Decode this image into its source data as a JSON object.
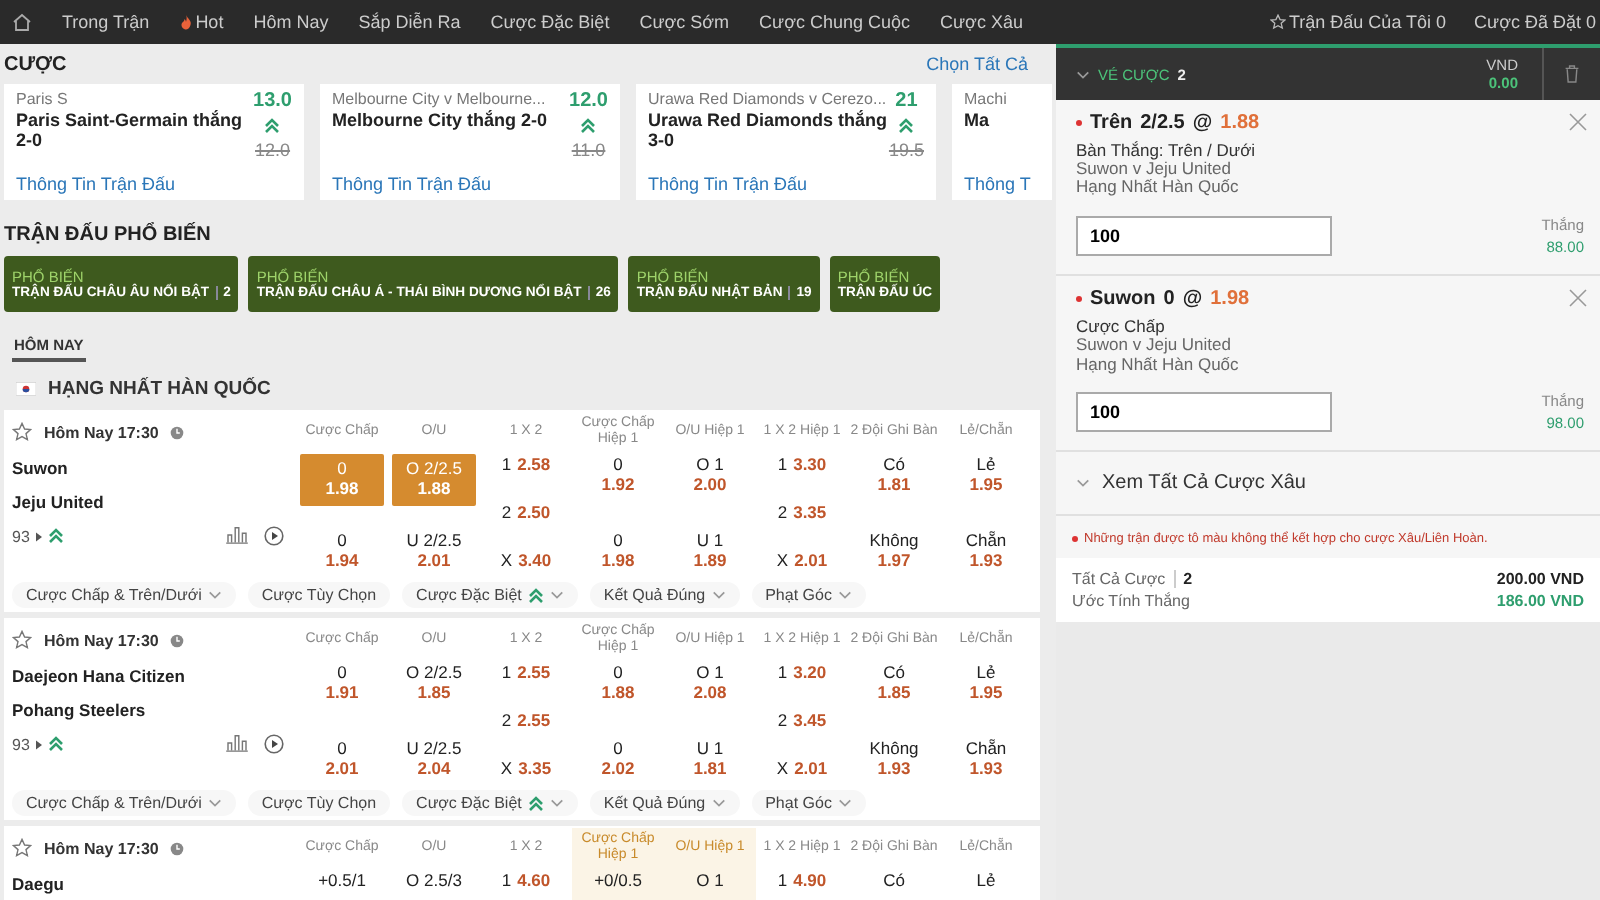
{
  "nav": {
    "items": [
      {
        "label": "Trong Trận",
        "kind": "text"
      },
      {
        "label": "Hot",
        "kind": "hot"
      },
      {
        "label": "Hôm Nay",
        "kind": "text"
      },
      {
        "label": "Sắp Diễn Ra",
        "kind": "text"
      },
      {
        "label": "Cược Đặc Biệt",
        "kind": "text"
      },
      {
        "label": "Cược Sớm",
        "kind": "text"
      },
      {
        "label": "Cược Chung Cuộc",
        "kind": "text"
      },
      {
        "label": "Cược Xâu",
        "kind": "text"
      }
    ],
    "right": [
      {
        "label": "Trận Đấu Của Tôi 0",
        "kind": "star"
      },
      {
        "label": "Cược Đã Đặt 0",
        "kind": "text"
      }
    ]
  },
  "featured": {
    "title": "CƯỢC",
    "select_all": "Chọn Tất Cả",
    "cards": [
      {
        "subtitle": "Paris S",
        "title": "Paris Saint-Germain thắng 2-0",
        "odd": "13.0",
        "old_odd": "12.0",
        "link": "Thông Tin Trận Đấu"
      },
      {
        "subtitle": "Melbourne City v Melbourne...",
        "title": "Melbourne City thắng 2-0",
        "odd": "12.0",
        "old_odd": "11.0",
        "link": "Thông Tin Trận Đấu"
      },
      {
        "subtitle": "Urawa Red Diamonds v Cerezo...",
        "title": "Urawa Red Diamonds thắng 3-0",
        "odd": "21",
        "old_odd": "19.5",
        "link": "Thông Tin Trận Đấu"
      },
      {
        "subtitle": "Machi",
        "title": "Ma",
        "link": "Thông T"
      }
    ]
  },
  "popular": {
    "title": "TRẬN ĐẤU PHỔ BIẾN",
    "cards": [
      {
        "tag": "PHỔ BIẾN",
        "title": "TRẬN ĐẤU CHÂU ÂU NỔI BẬT",
        "count": "2"
      },
      {
        "tag": "PHỔ BIẾN",
        "title": "TRẬN ĐẤU CHÂU Á - THÁI BÌNH DƯƠNG NỔI BẬT",
        "count": "26"
      },
      {
        "tag": "PHỔ BIẾN",
        "title": "TRẬN ĐẤU NHẬT BẢN",
        "count": "19"
      },
      {
        "tag": "PHỔ BIẾN",
        "title": "TRẬN ĐẤU ÚC"
      }
    ]
  },
  "day_tab": {
    "label": "HÔM NAY",
    "selected": true
  },
  "league": "HẠNG NHẤT HÀN QUỐC",
  "matches": [
    {
      "time": "Hôm Nay 17:30",
      "teams": [
        "Suwon",
        "Jeju United"
      ],
      "count": "93",
      "columns": [
        {
          "heading": "Cược Chấp",
          "highlighted": false,
          "kind": "stacked",
          "cells": [
            {
              "label": "0",
              "odd": "1.98",
              "selected": true
            },
            {
              "label": "0",
              "odd": "1.94",
              "selected": false
            }
          ]
        },
        {
          "heading": "O/U",
          "highlighted": false,
          "kind": "stacked",
          "cells": [
            {
              "label": "O 2/2.5",
              "odd": "1.88",
              "selected": true
            },
            {
              "label": "U 2/2.5",
              "odd": "2.01",
              "selected": false
            }
          ]
        },
        {
          "heading": "1 X 2",
          "highlighted": false,
          "kind": "inline",
          "cells": [
            {
              "label": "1",
              "odd": "2.58",
              "selected": false
            },
            {
              "label": "2",
              "odd": "2.50",
              "selected": false
            },
            {
              "label": "X",
              "odd": "3.40",
              "selected": false
            }
          ]
        },
        {
          "heading": "Cược Chấp Hiệp 1",
          "highlighted": false,
          "kind": "stacked",
          "cells": [
            {
              "label": "0",
              "odd": "1.92",
              "selected": false
            },
            {
              "label": "0",
              "odd": "1.98",
              "selected": false
            }
          ]
        },
        {
          "heading": "O/U Hiệp 1",
          "highlighted": false,
          "kind": "stacked",
          "cells": [
            {
              "label": "O 1",
              "odd": "2.00",
              "selected": false
            },
            {
              "label": "U 1",
              "odd": "1.89",
              "selected": false
            }
          ]
        },
        {
          "heading": "1 X 2 Hiệp 1",
          "highlighted": false,
          "kind": "inline",
          "cells": [
            {
              "label": "1",
              "odd": "3.30",
              "selected": false
            },
            {
              "label": "2",
              "odd": "3.35",
              "selected": false
            },
            {
              "label": "X",
              "odd": "2.01",
              "selected": false
            }
          ]
        },
        {
          "heading": "2 Đội Ghi Bàn",
          "highlighted": false,
          "kind": "stacked",
          "cells": [
            {
              "label": "Có",
              "odd": "1.81",
              "selected": false
            },
            {
              "label": "Không",
              "odd": "1.97",
              "selected": false
            }
          ]
        },
        {
          "heading": "Lẻ/Chẵn",
          "highlighted": false,
          "kind": "stacked",
          "cells": [
            {
              "label": "Lẻ",
              "odd": "1.95",
              "selected": false
            },
            {
              "label": "Chẵn",
              "odd": "1.93",
              "selected": false
            }
          ]
        }
      ],
      "markets": [
        {
          "label": "Cược Chấp & Trên/Dưới",
          "boosted": false,
          "caret": true
        },
        {
          "label": "Cược Tùy Chọn",
          "boosted": false,
          "caret": false
        },
        {
          "label": "Cược Đặc Biệt",
          "boosted": true,
          "caret": true
        },
        {
          "label": "Kết Quả Đúng",
          "boosted": false,
          "caret": true
        },
        {
          "label": "Phạt Góc",
          "boosted": false,
          "caret": true
        }
      ]
    },
    {
      "time": "Hôm Nay 17:30",
      "teams": [
        "Daejeon Hana Citizen",
        "Pohang Steelers"
      ],
      "count": "93",
      "columns": [
        {
          "heading": "Cược Chấp",
          "highlighted": false,
          "kind": "stacked",
          "cells": [
            {
              "label": "0",
              "odd": "1.91",
              "selected": false
            },
            {
              "label": "0",
              "odd": "2.01",
              "selected": false
            }
          ]
        },
        {
          "heading": "O/U",
          "highlighted": false,
          "kind": "stacked",
          "cells": [
            {
              "label": "O 2/2.5",
              "odd": "1.85",
              "selected": false
            },
            {
              "label": "U 2/2.5",
              "odd": "2.04",
              "selected": false
            }
          ]
        },
        {
          "heading": "1 X 2",
          "highlighted": false,
          "kind": "inline",
          "cells": [
            {
              "label": "1",
              "odd": "2.55",
              "selected": false
            },
            {
              "label": "2",
              "odd": "2.55",
              "selected": false
            },
            {
              "label": "X",
              "odd": "3.35",
              "selected": false
            }
          ]
        },
        {
          "heading": "Cược Chấp Hiệp 1",
          "highlighted": false,
          "kind": "stacked",
          "cells": [
            {
              "label": "0",
              "odd": "1.88",
              "selected": false
            },
            {
              "label": "0",
              "odd": "2.02",
              "selected": false
            }
          ]
        },
        {
          "heading": "O/U Hiệp 1",
          "highlighted": false,
          "kind": "stacked",
          "cells": [
            {
              "label": "O 1",
              "odd": "2.08",
              "selected": false
            },
            {
              "label": "U 1",
              "odd": "1.81",
              "selected": false
            }
          ]
        },
        {
          "heading": "1 X 2 Hiệp 1",
          "highlighted": false,
          "kind": "inline",
          "cells": [
            {
              "label": "1",
              "odd": "3.20",
              "selected": false
            },
            {
              "label": "2",
              "odd": "3.45",
              "selected": false
            },
            {
              "label": "X",
              "odd": "2.01",
              "selected": false
            }
          ]
        },
        {
          "heading": "2 Đội Ghi Bàn",
          "highlighted": false,
          "kind": "stacked",
          "cells": [
            {
              "label": "Có",
              "odd": "1.85",
              "selected": false
            },
            {
              "label": "Không",
              "odd": "1.93",
              "selected": false
            }
          ]
        },
        {
          "heading": "Lẻ/Chẵn",
          "highlighted": false,
          "kind": "stacked",
          "cells": [
            {
              "label": "Lẻ",
              "odd": "1.95",
              "selected": false
            },
            {
              "label": "Chẵn",
              "odd": "1.93",
              "selected": false
            }
          ]
        }
      ],
      "markets": [
        {
          "label": "Cược Chấp & Trên/Dưới",
          "boosted": false,
          "caret": true
        },
        {
          "label": "Cược Tùy Chọn",
          "boosted": false,
          "caret": false
        },
        {
          "label": "Cược Đặc Biệt",
          "boosted": true,
          "caret": true
        },
        {
          "label": "Kết Quả Đúng",
          "boosted": false,
          "caret": true
        },
        {
          "label": "Phạt Góc",
          "boosted": false,
          "caret": true
        }
      ]
    },
    {
      "time": "Hôm Nay 17:30",
      "teams": [
        "Daegu"
      ],
      "columns": [
        {
          "heading": "Cược Chấp",
          "highlighted": false,
          "kind": "stacked",
          "cells": [
            {
              "label": "+0.5/1",
              "selected": false
            }
          ]
        },
        {
          "heading": "O/U",
          "highlighted": false,
          "kind": "stacked",
          "cells": [
            {
              "label": "O 2.5/3",
              "selected": false
            }
          ]
        },
        {
          "heading": "1 X 2",
          "highlighted": false,
          "kind": "inline",
          "cells": [
            {
              "label": "1",
              "odd": "4.60",
              "selected": false
            }
          ]
        },
        {
          "heading": "Cược Chấp Hiệp 1",
          "highlighted": true,
          "kind": "stacked",
          "cells": [
            {
              "label": "+0/0.5",
              "selected": false
            }
          ]
        },
        {
          "heading": "O/U Hiệp 1",
          "highlighted": true,
          "kind": "stacked",
          "cells": [
            {
              "label": "O 1",
              "selected": false
            }
          ]
        },
        {
          "heading": "1 X 2 Hiệp 1",
          "highlighted": false,
          "kind": "inline",
          "cells": [
            {
              "label": "1",
              "odd": "4.90",
              "selected": false
            }
          ]
        },
        {
          "heading": "2 Đội Ghi Bàn",
          "highlighted": false,
          "kind": "stacked",
          "cells": [
            {
              "label": "Có",
              "selected": false
            }
          ]
        },
        {
          "heading": "Lẻ/Chẵn",
          "highlighted": false,
          "kind": "stacked",
          "cells": [
            {
              "label": "Lẻ",
              "selected": false
            }
          ]
        }
      ]
    }
  ],
  "betslip": {
    "title": "VÉ CƯỢC",
    "count": "2",
    "currency": "VND",
    "balance": "0.00",
    "bets": [
      {
        "pick": "Trên",
        "line": "2/2.5",
        "at": "@",
        "odd": "1.88",
        "market": "Bàn Thắng: Trên / Dưới",
        "match": "Suwon v Jeju United",
        "league": "Hạng Nhất Hàn Quốc",
        "stake": "100",
        "win_label": "Thắng",
        "win": "88.00"
      },
      {
        "pick": "Suwon",
        "line": "0",
        "at": "@",
        "odd": "1.98",
        "market": "Cược Chấp",
        "match": "Suwon v Jeju United",
        "league": "Hạng Nhất Hàn Quốc",
        "stake": "100",
        "win_label": "Thắng",
        "win": "98.00"
      }
    ],
    "parlay_link": "Xem Tất Cả Cược Xâu",
    "warning": "Những trận được tô màu không thể kết hợp cho cược Xâu/Liên Hoàn.",
    "total_label": "Tất Cả Cược",
    "total_count": "2",
    "total": "200.00 VND",
    "est_label": "Ước Tính Thắng",
    "est": "186.00 VND"
  }
}
